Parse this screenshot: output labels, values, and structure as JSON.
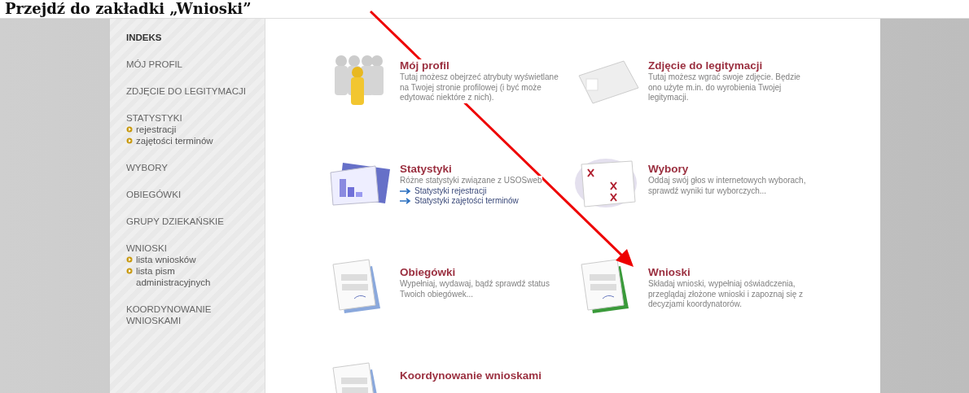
{
  "heading": "Przejdź do zakładki „Wnioski”",
  "sidebar": {
    "items": [
      {
        "label": "INDEKS",
        "selected": true
      },
      {
        "label": "MÓJ PROFIL",
        "selected": false
      },
      {
        "label": "ZDJĘCIE DO LEGITYMACJI",
        "selected": false
      },
      {
        "label": "STATYSTYKI",
        "selected": false,
        "children": [
          {
            "label": "rejestracji"
          },
          {
            "label": "zajętości terminów"
          }
        ]
      },
      {
        "label": "WYBORY",
        "selected": false
      },
      {
        "label": "OBIEGÓWKI",
        "selected": false
      },
      {
        "label": "GRUPY DZIEKAŃSKIE",
        "selected": false
      },
      {
        "label": "WNIOSKI",
        "selected": false,
        "children": [
          {
            "label": "lista wniosków"
          },
          {
            "label": "lista pism administracyjnych"
          }
        ]
      },
      {
        "label": "KOORDYNOWANIE WNIOSKAMI",
        "selected": false
      }
    ]
  },
  "cards": [
    {
      "title": "Mój profil",
      "description": "Tutaj możesz obejrzeć atrybuty wyświetlane na Twojej stronie profilowej (i być może edytować niektóre z nich)."
    },
    {
      "title": "Zdjęcie do legitymacji",
      "description": "Tutaj możesz wgrać swoje zdjęcie. Będzie ono użyte m.in. do wyrobienia Twojej legitymacji."
    },
    {
      "title": "Statystyki",
      "description": "Różne statystyki związane z USOSweb",
      "links": [
        "Statystyki rejestracji",
        "Statystyki zajętości terminów"
      ]
    },
    {
      "title": "Wybory",
      "description": "Oddaj swój głos w internetowych wyborach, sprawdź wyniki tur wyborczych..."
    },
    {
      "title": "Obiegówki",
      "description": "Wypełniaj, wydawaj, bądź sprawdź status Twoich obiegówek..."
    },
    {
      "title": "Wnioski",
      "description": "Składaj wnioski, wypełniaj oświadczenia, przeglądaj złożone wnioski i zapoznaj się z decyzjami koordynatorów."
    },
    {
      "title": "Koordynowanie wnioskami"
    }
  ]
}
